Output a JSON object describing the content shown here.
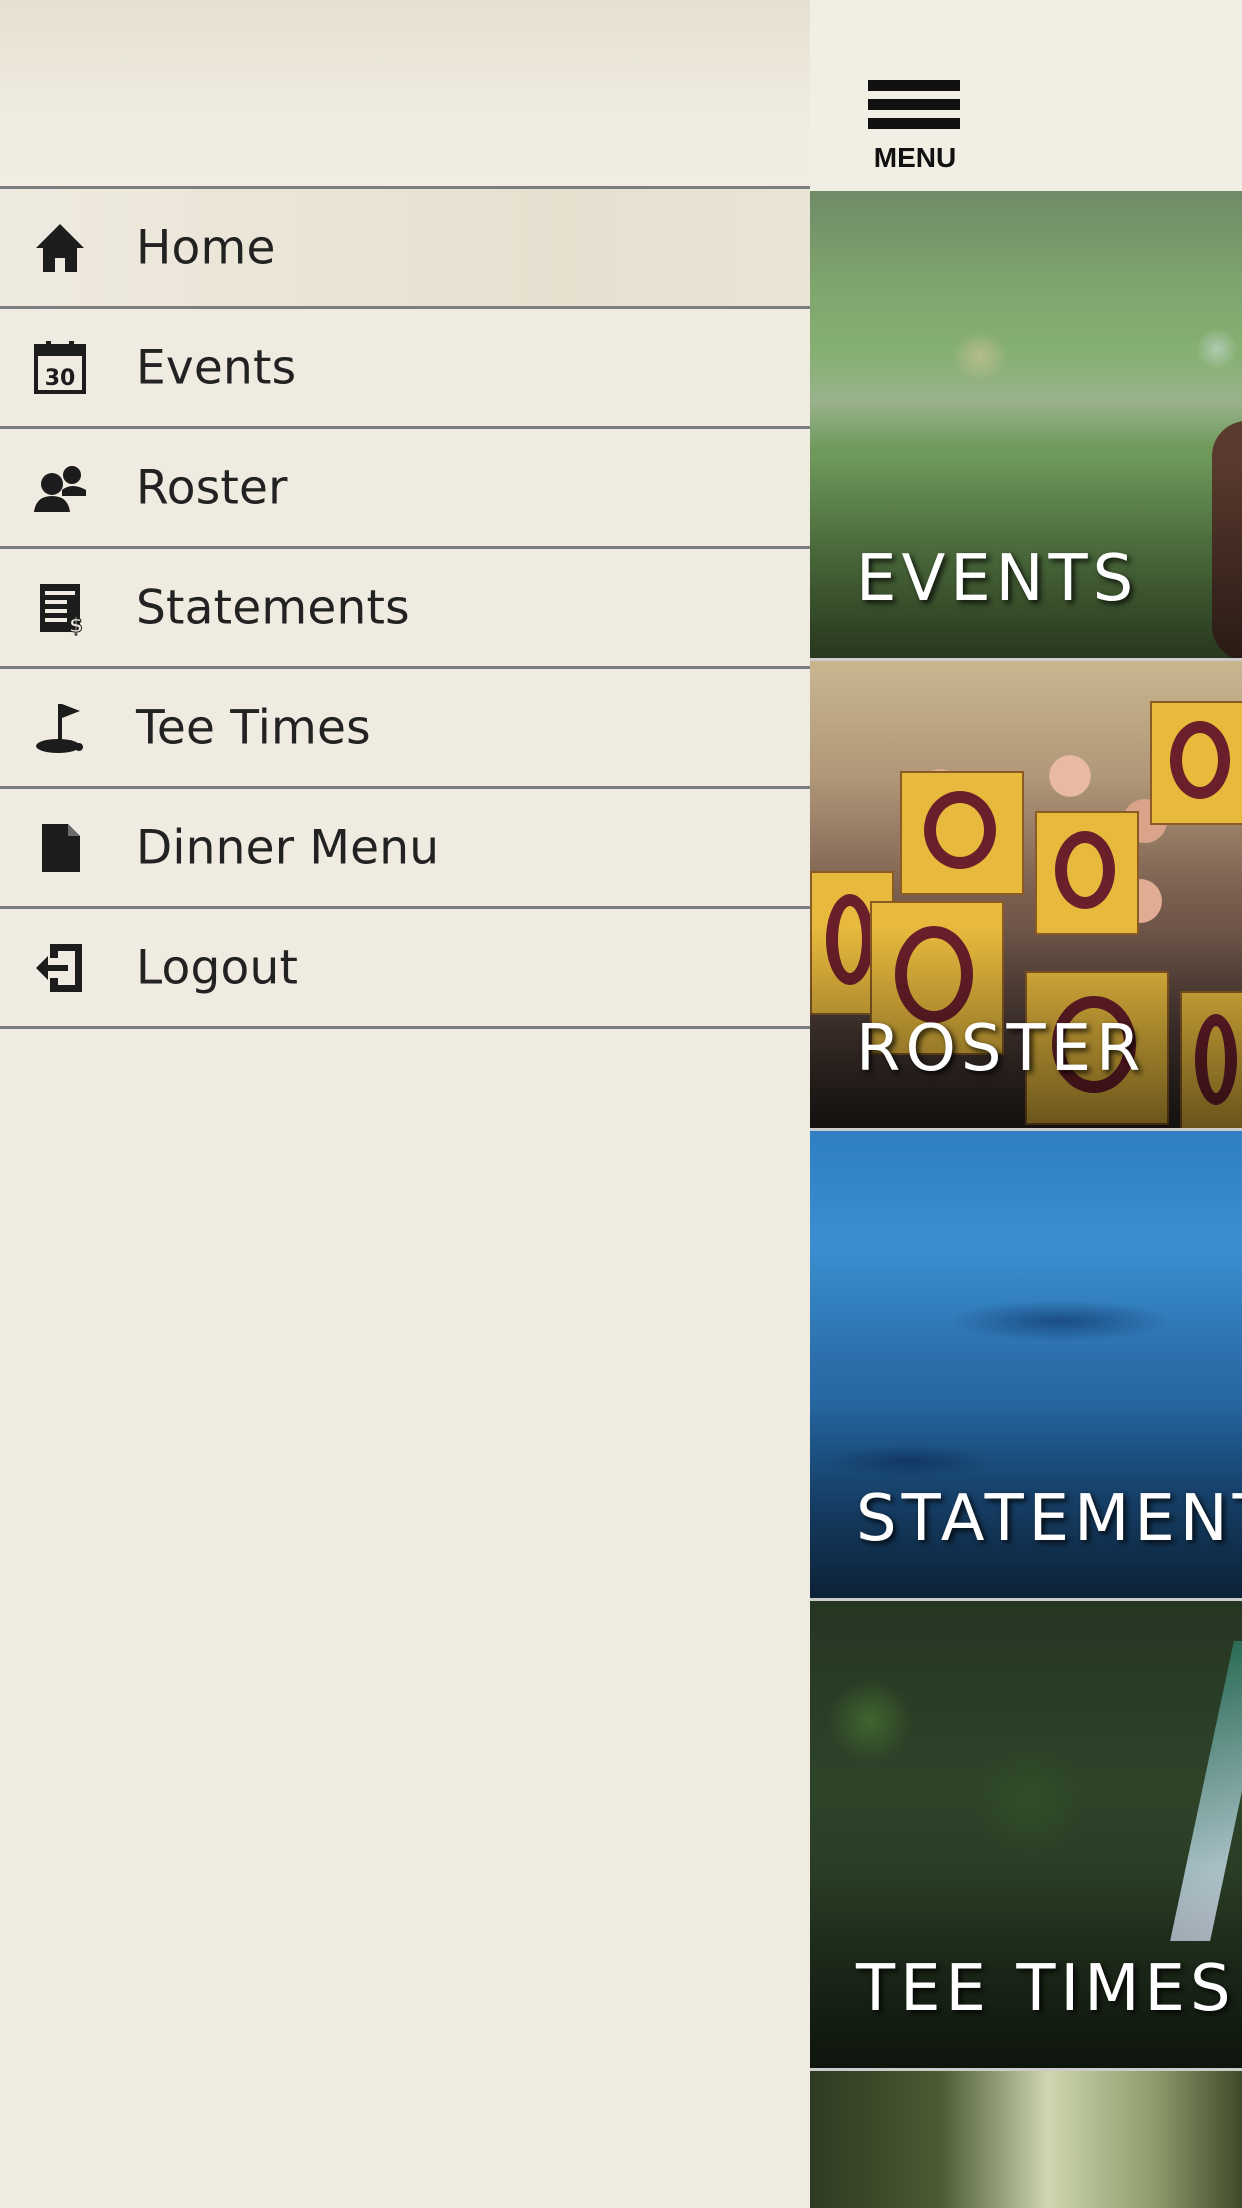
{
  "drawer": {
    "items": [
      {
        "label": "Home",
        "icon": "home-icon",
        "active": true
      },
      {
        "label": "Events",
        "icon": "calendar-icon",
        "calendar_day": "30"
      },
      {
        "label": "Roster",
        "icon": "people-icon"
      },
      {
        "label": "Statements",
        "icon": "statement-icon"
      },
      {
        "label": "Tee Times",
        "icon": "golf-flag-icon"
      },
      {
        "label": "Dinner Menu",
        "icon": "document-icon"
      },
      {
        "label": "Logout",
        "icon": "logout-icon"
      }
    ]
  },
  "topbar": {
    "menu_label": "MENU"
  },
  "tiles": [
    {
      "label": "EVENTS"
    },
    {
      "label": "ROSTER"
    },
    {
      "label": "STATEMENTS"
    },
    {
      "label": "TEE TIMES"
    }
  ],
  "colors": {
    "drawer_background": "#efebe1",
    "divider": "#7b7f82",
    "text": "#222222"
  }
}
